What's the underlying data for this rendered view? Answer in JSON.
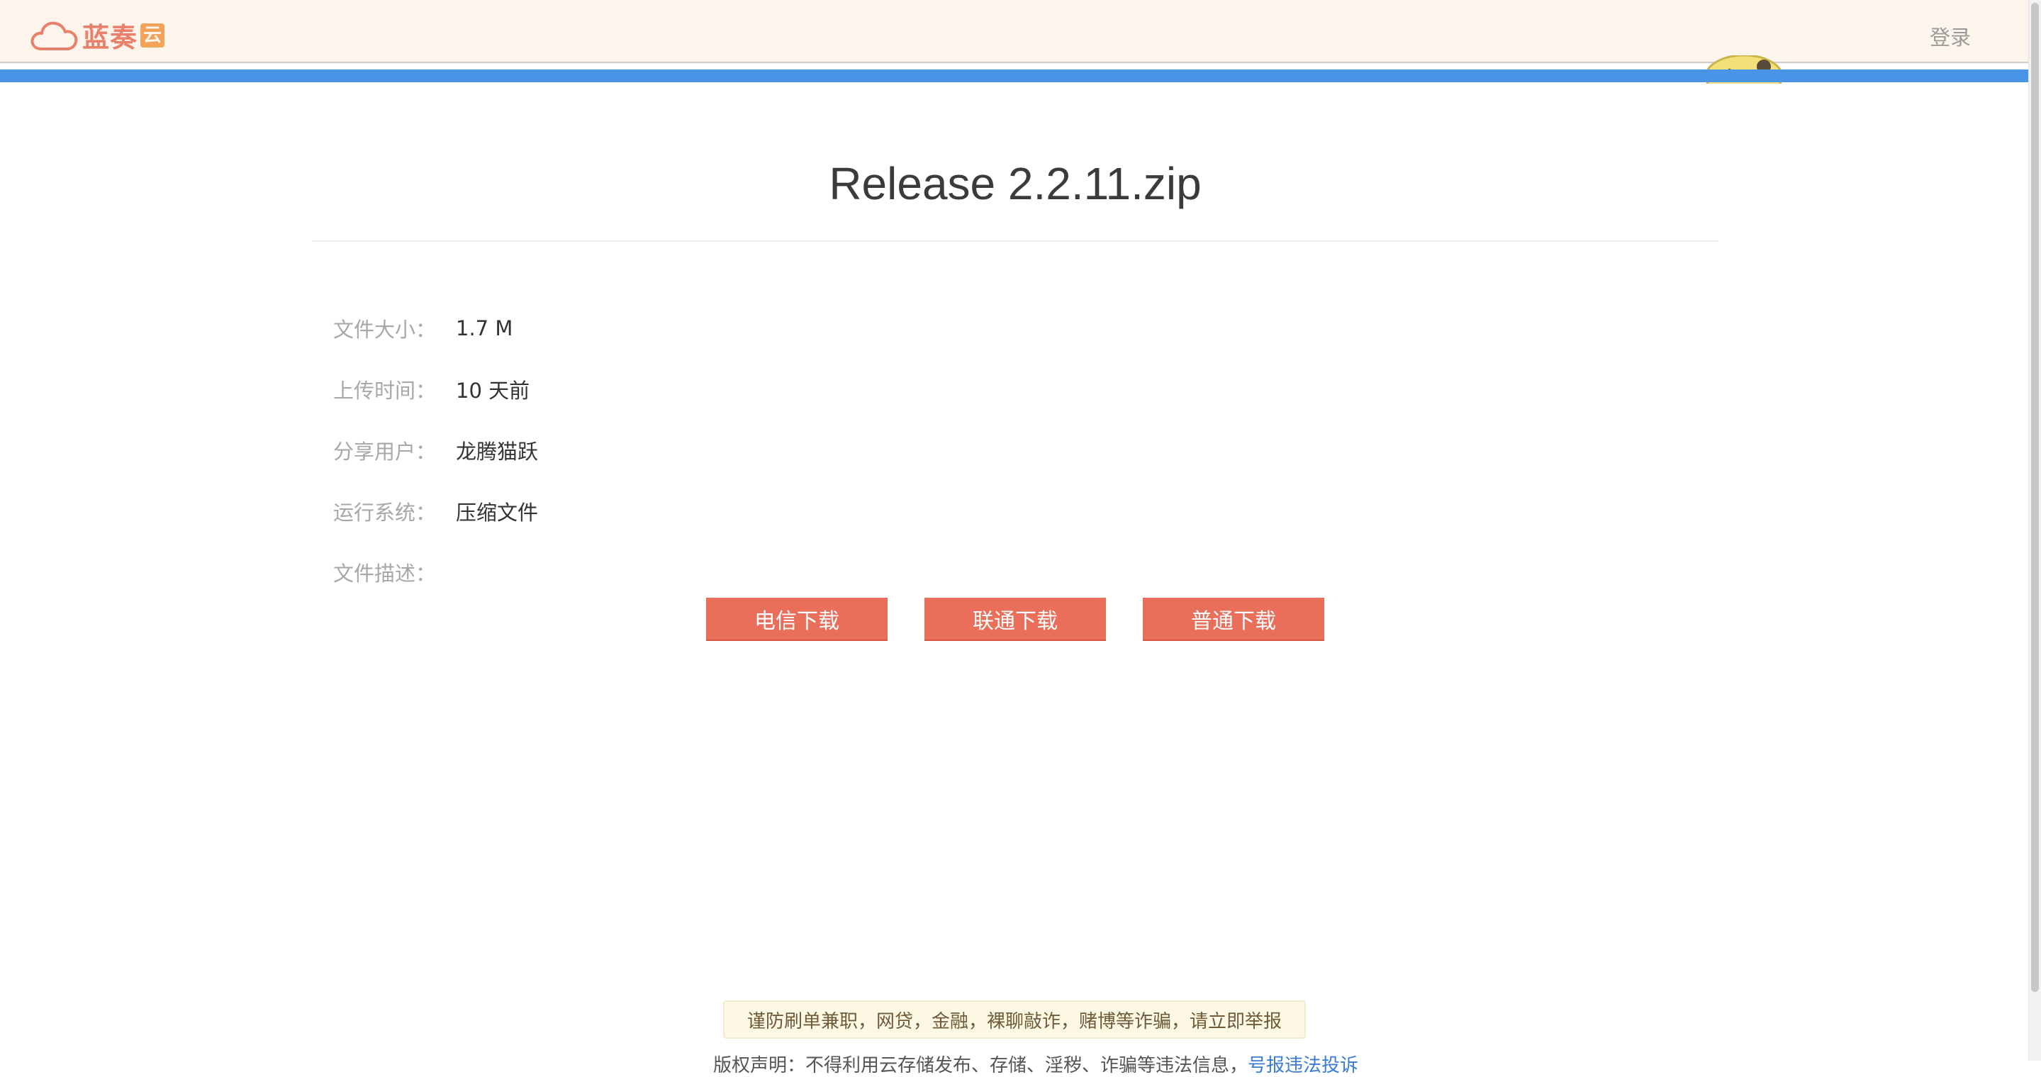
{
  "header": {
    "logo_text": "蓝奏",
    "logo_badge": "云",
    "login_label": "登录"
  },
  "file": {
    "title": "Release 2.2.11.zip"
  },
  "info": [
    {
      "label": "文件大小：",
      "value": "1.7 M"
    },
    {
      "label": "上传时间：",
      "value": "10 天前"
    },
    {
      "label": "分享用户：",
      "value": "龙腾猫跃"
    },
    {
      "label": "运行系统：",
      "value": "压缩文件"
    },
    {
      "label": "文件描述：",
      "value": ""
    }
  ],
  "buttons": {
    "telecom": "电信下载",
    "unicom": "联通下载",
    "normal": "普通下载"
  },
  "footer": {
    "warning": "谨防刷单兼职，网贷，金融，裸聊敲诈，赌博等诈骗，请立即举报",
    "statement": "版权声明：不得利用云存储发布、存储、淫秽、诈骗等违法信息，",
    "report_link": "号报违法投诉"
  },
  "colors": {
    "header_bg": "#fdf5eb",
    "blue_bar": "#4a94e8",
    "button": "#ea6f5a",
    "logo": "#e9806b"
  }
}
